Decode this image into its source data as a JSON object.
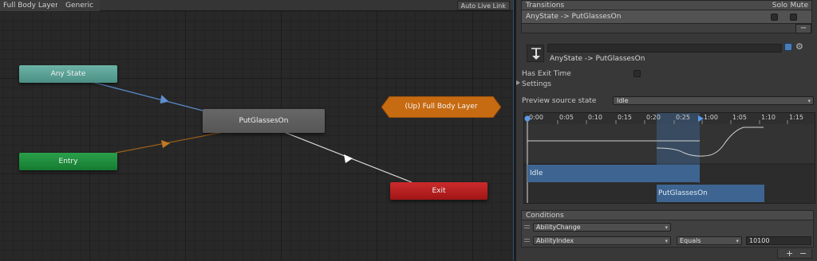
{
  "graph": {
    "breadcrumbs": [
      "Full Body Layer",
      "Generic"
    ],
    "auto_live_link": "Auto Live Link",
    "nodes": {
      "any_state": "Any State",
      "entry": "Entry",
      "put_glasses": "PutGlassesOn",
      "up_layer": "(Up) Full Body Layer",
      "exit": "Exit"
    },
    "colors": {
      "any_state": "#5ea99d",
      "entry": "#1e8c3c",
      "state": "#5e5e5e",
      "up_layer": "#c76b12",
      "exit": "#b51f1f",
      "transition_blue": "#5d8fd1",
      "transition_orange": "#a0601a",
      "transition_white": "#e6e6e6"
    }
  },
  "inspector": {
    "transitions_header": "Transitions",
    "solo_label": "Solo",
    "mute_label": "Mute",
    "transition_row": "AnyState -> PutGlassesOn",
    "transition_title": "AnyState -> PutGlassesOn",
    "has_exit_time_label": "Has Exit Time",
    "settings_label": "Settings",
    "preview_source_label": "Preview source state",
    "preview_source_value": "Idle",
    "timeline": {
      "ticks": [
        "0:00",
        "0:05",
        "0:10",
        "0:15",
        "0:20",
        "0:25",
        "1:00",
        "1:05",
        "1:10",
        "1:15"
      ],
      "idle_label": "Idle",
      "put_label": "PutGlassesOn"
    },
    "conditions_header": "Conditions",
    "conditions": [
      {
        "parameter": "AbilityChange"
      },
      {
        "parameter": "AbilityIndex",
        "operator": "Equals",
        "value": "10100"
      }
    ],
    "remove_symbol": "−",
    "add_symbol": "+"
  }
}
